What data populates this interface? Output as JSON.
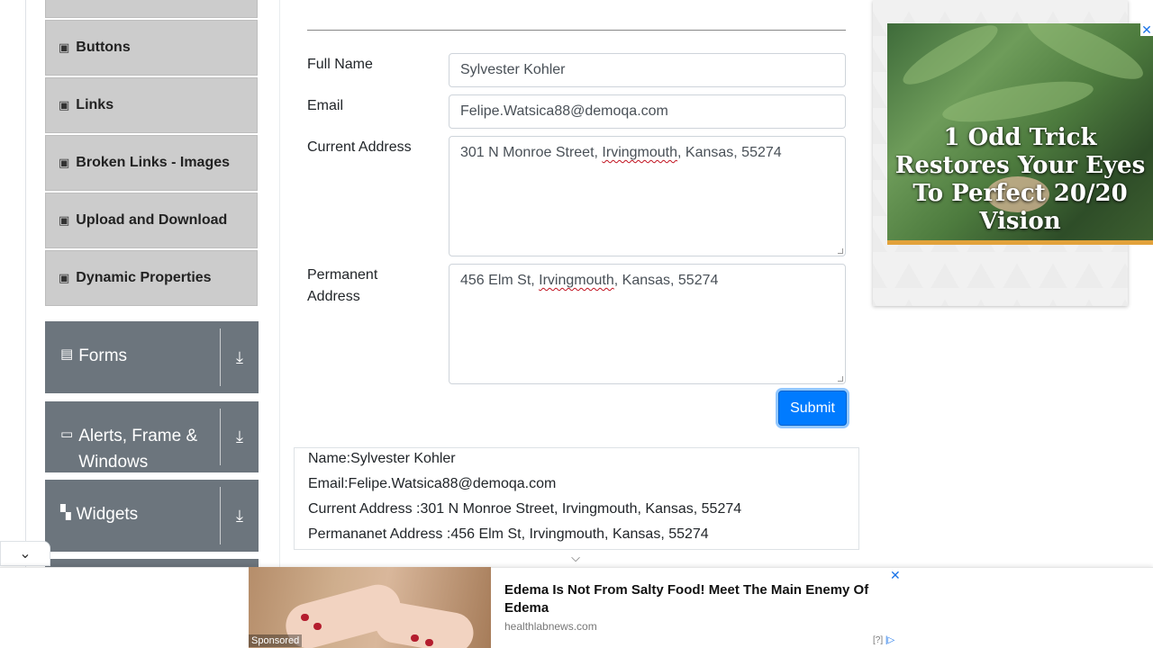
{
  "sidebar": {
    "sub_items": [
      "Buttons",
      "Links",
      "Broken Links - Images",
      "Upload and Download",
      "Dynamic Properties"
    ],
    "groups": [
      {
        "label": "Forms",
        "icon": "list-icon"
      },
      {
        "label": "Alerts, Frame & Windows",
        "icon": "window-icon"
      },
      {
        "label": "Widgets",
        "icon": "widgets-icon"
      }
    ]
  },
  "form": {
    "full_name_label": "Full Name",
    "full_name_value": "Sylvester Kohler",
    "email_label": "Email",
    "email_value": "Felipe.Watsica88@demoqa.com",
    "current_address_label": "Current Address",
    "current_address_parts": [
      "301 N Monroe Street, ",
      "Irvingmouth",
      ", Kansas, 55274"
    ],
    "permanent_address_label_1": "Permanent",
    "permanent_address_label_2": "Address",
    "permanent_address_parts": [
      "456 Elm St, ",
      "Irvingmouth",
      ", Kansas, 55274"
    ],
    "submit_label": "Submit"
  },
  "output": {
    "name": "Name:Sylvester Kohler",
    "email": "Email:Felipe.Watsica88@demoqa.com",
    "current_address": "Current Address :301 N Monroe Street, Irvingmouth, Kansas, 55274",
    "permanent_address": "Permananet Address :456 Elm St, Irvingmouth, Kansas, 55274"
  },
  "right_ad": {
    "headline": "1 Odd Trick Restores Your Eyes To Perfect 20/20 Vision",
    "close": "✕"
  },
  "bottom_ad": {
    "sponsored": "Sponsored",
    "title": "Edema Is Not From Salty Food! Meet The Main Enemy Of Edema",
    "domain": "healthlabnews.com",
    "info": "[?]",
    "close": "✕"
  },
  "colors": {
    "accent": "#007bff",
    "sidebar_group": "#6c757d",
    "sidebar_item": "#cccccc"
  }
}
